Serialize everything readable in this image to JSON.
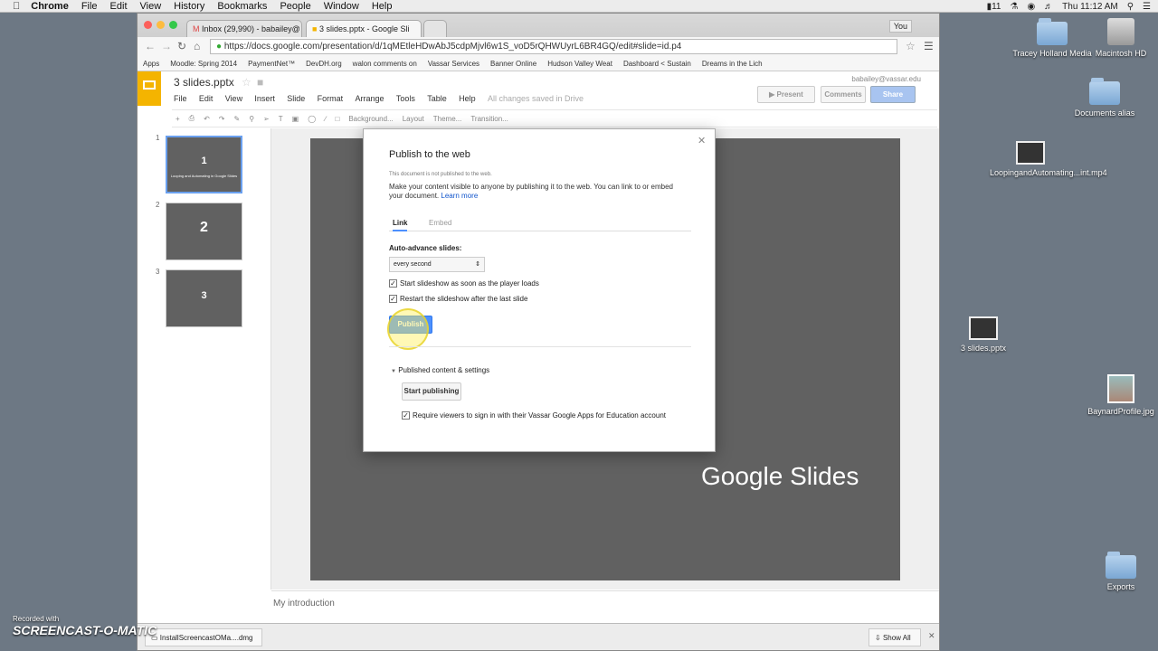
{
  "mac_menu": {
    "app": "Chrome",
    "items": [
      "File",
      "Edit",
      "View",
      "History",
      "Bookmarks",
      "People",
      "Window",
      "Help"
    ],
    "status_battery": "11",
    "clock": "Thu 11:12 AM"
  },
  "desktop": {
    "icons": [
      {
        "label": "Tracey Holland Media"
      },
      {
        "label": "Macintosh HD"
      },
      {
        "label": "Documents alias"
      },
      {
        "label": "LoopingandAutomating...int.mp4"
      },
      {
        "label": "3 slides.pptx"
      },
      {
        "label": "BaynardProfile.jpg"
      },
      {
        "label": "Exports"
      }
    ]
  },
  "browser": {
    "tabs": [
      {
        "title": "Inbox (29,990) - babailey@"
      },
      {
        "title": "3 slides.pptx - Google Sli"
      }
    ],
    "profile": "You",
    "url": "https://docs.google.com/presentation/d/1qMEtleHDwAbJ5cdpMjvl6w1S_voD5rQHWUyrL6BR4GQ/edit#slide=id.p4",
    "bookmarks": [
      "Apps",
      "Moodle: Spring 2014",
      "PaymentNet™",
      "DevDH.org",
      "walon comments on",
      "Vassar Services",
      "Banner Online",
      "Hudson Valley Weat",
      "Dashboard < Sustain",
      "Dreams in the Lich"
    ]
  },
  "doc": {
    "title": "3 slides.pptx",
    "user": "babailey@vassar.edu",
    "menus": [
      "File",
      "Edit",
      "View",
      "Insert",
      "Slide",
      "Format",
      "Arrange",
      "Tools",
      "Table",
      "Help"
    ],
    "save_status": "All changes saved in Drive",
    "present_label": "Present",
    "comments_label": "Comments",
    "share_label": "Share",
    "toolbar": [
      "Background...",
      "Layout",
      "Theme...",
      "Transition..."
    ],
    "slides": [
      {
        "num": "1",
        "big": "1",
        "sub": "Looping and Automating in Google Slides"
      },
      {
        "num": "2",
        "big": "2"
      },
      {
        "num": "3",
        "big": "3"
      }
    ],
    "slide_visible_text": "Google Slides",
    "notes": "My introduction"
  },
  "dialog": {
    "title": "Publish to the web",
    "status": "This document is not published to the web.",
    "description": "Make your content visible to anyone by publishing it to the web. You can link to or embed your document.",
    "learn_more": "Learn more",
    "tabs": [
      "Link",
      "Embed"
    ],
    "auto_advance_label": "Auto-advance slides:",
    "auto_advance_value": "every second",
    "opt1": "Start slideshow as soon as the player loads",
    "opt2": "Restart the slideshow after the last slide",
    "publish_label": "Publish",
    "published_section": "Published content & settings",
    "start_publishing": "Start publishing",
    "require_signin": "Require viewers to sign in with their Vassar Google Apps for Education account"
  },
  "downloads": {
    "file": "InstallScreencastOMa....dmg",
    "show_all": "Show All"
  },
  "watermark": {
    "line1": "Recorded with",
    "line2": "SCREENCAST-O-MATIC"
  }
}
